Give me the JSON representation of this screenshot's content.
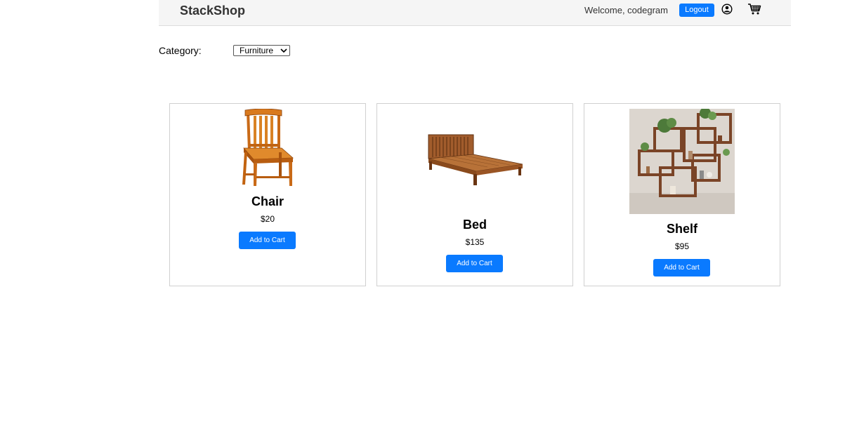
{
  "header": {
    "brand": "StackShop",
    "welcome": "Welcome, codegram",
    "logout_label": "Logout",
    "user_icon": "user-circle-icon",
    "cart_icon": "shopping-cart-icon"
  },
  "filter": {
    "label": "Category:",
    "selected": "Furniture"
  },
  "products": [
    {
      "name": "Chair",
      "price": "$20",
      "button": "Add to Cart",
      "image": "chair-image"
    },
    {
      "name": "Bed",
      "price": "$135",
      "button": "Add to Cart",
      "image": "bed-image"
    },
    {
      "name": "Shelf",
      "price": "$95",
      "button": "Add to Cart",
      "image": "shelf-image"
    }
  ],
  "colors": {
    "accent": "#0a7aff",
    "header_bg": "#f5f5f5",
    "wood": "#b5602a"
  }
}
